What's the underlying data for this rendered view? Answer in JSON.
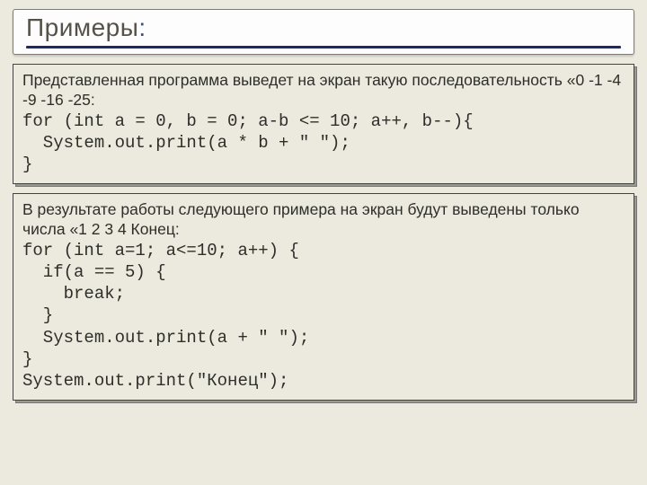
{
  "title": "Примеры",
  "title_colon": ":",
  "example1": {
    "intro": "Представленная программа выведет на экран такую последовательность «0 -1 -4 -9 -16 -25:",
    "code": "for (int a = 0, b = 0; a-b <= 10; a++, b--){\n  System.out.print(a * b + \" \");\n}"
  },
  "example2": {
    "intro": "В результате работы следующего примера на экран будут выведены только числа «1 2 3 4 Конец:",
    "code": "for (int a=1; a<=10; a++) {\n  if(a == 5) {\n    break;\n  }\n  System.out.print(a + \" \");\n}\nSystem.out.print(\"Конец\");"
  }
}
